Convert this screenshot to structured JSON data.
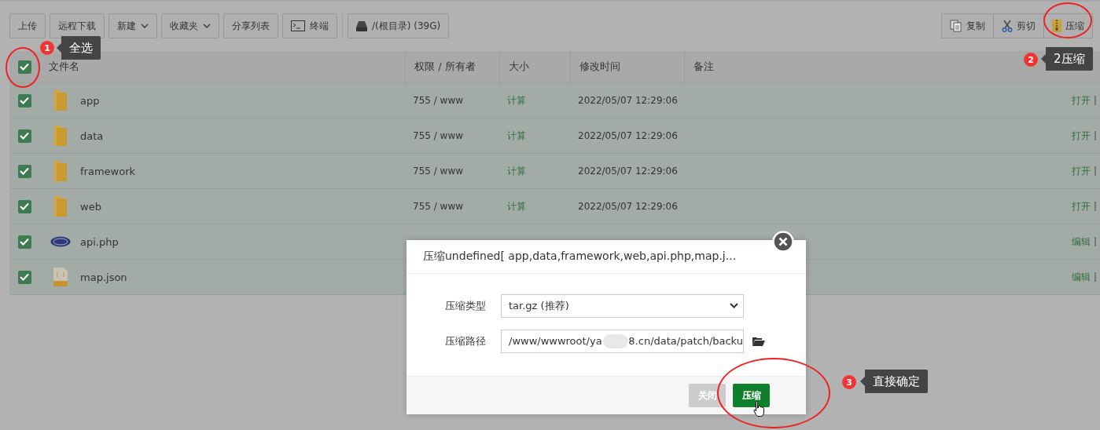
{
  "toolbar": {
    "left": [
      {
        "label": "上传",
        "kind": "plain"
      },
      {
        "label": "远程下载",
        "kind": "plain"
      },
      {
        "label": "新建",
        "kind": "dropdown"
      },
      {
        "label": "收藏夹",
        "kind": "dropdown"
      },
      {
        "label": "分享列表",
        "kind": "plain"
      },
      {
        "label": "终端",
        "kind": "terminal"
      },
      {
        "label": "/(根目录) (39G)",
        "kind": "disk"
      }
    ],
    "right": [
      {
        "label": "复制",
        "kind": "copy"
      },
      {
        "label": "剪切",
        "kind": "cut"
      },
      {
        "label": "压缩",
        "kind": "zip"
      }
    ]
  },
  "table": {
    "select_all_checked": true,
    "columns": [
      "文件名",
      "权限 / 所有者",
      "大小",
      "修改时间",
      "备注"
    ],
    "rows": [
      {
        "name": "app",
        "kind": "folder",
        "checked": true,
        "perms": "755 / www",
        "size": "计算",
        "mtime": "2022/05/07 12:29:06",
        "action": "打开"
      },
      {
        "name": "data",
        "kind": "folder",
        "checked": true,
        "perms": "755 / www",
        "size": "计算",
        "mtime": "2022/05/07 12:29:06",
        "action": "打开"
      },
      {
        "name": "framework",
        "kind": "folder",
        "checked": true,
        "perms": "755 / www",
        "size": "计算",
        "mtime": "2022/05/07 12:29:06",
        "action": "打开"
      },
      {
        "name": "web",
        "kind": "folder",
        "checked": true,
        "perms": "755 / www",
        "size": "计算",
        "mtime": "2022/05/07 12:29:06",
        "action": "打开"
      },
      {
        "name": "api.php",
        "kind": "php",
        "checked": true,
        "action": "编辑"
      },
      {
        "name": "map.json",
        "kind": "json",
        "checked": true,
        "action": "编辑"
      }
    ]
  },
  "dialog": {
    "title": "压缩undefined[ app,data,framework,web,api.php,map.j...",
    "fields": [
      {
        "label": "压缩类型",
        "kind": "select",
        "value": "tar.gz (推荐)"
      },
      {
        "label": "压缩路径",
        "kind": "path",
        "value_parts": [
          "/www/wwwroot/ya",
          "8.cn/data/patch/backu"
        ]
      }
    ],
    "buttons": [
      {
        "label": "关闭",
        "kind": "secondary"
      },
      {
        "label": "压缩",
        "kind": "primary"
      }
    ]
  },
  "annotations": [
    {
      "number": "1",
      "text": "全选"
    },
    {
      "number": "2",
      "text": "2压缩"
    },
    {
      "number": "3",
      "text": "直接确定"
    }
  ]
}
